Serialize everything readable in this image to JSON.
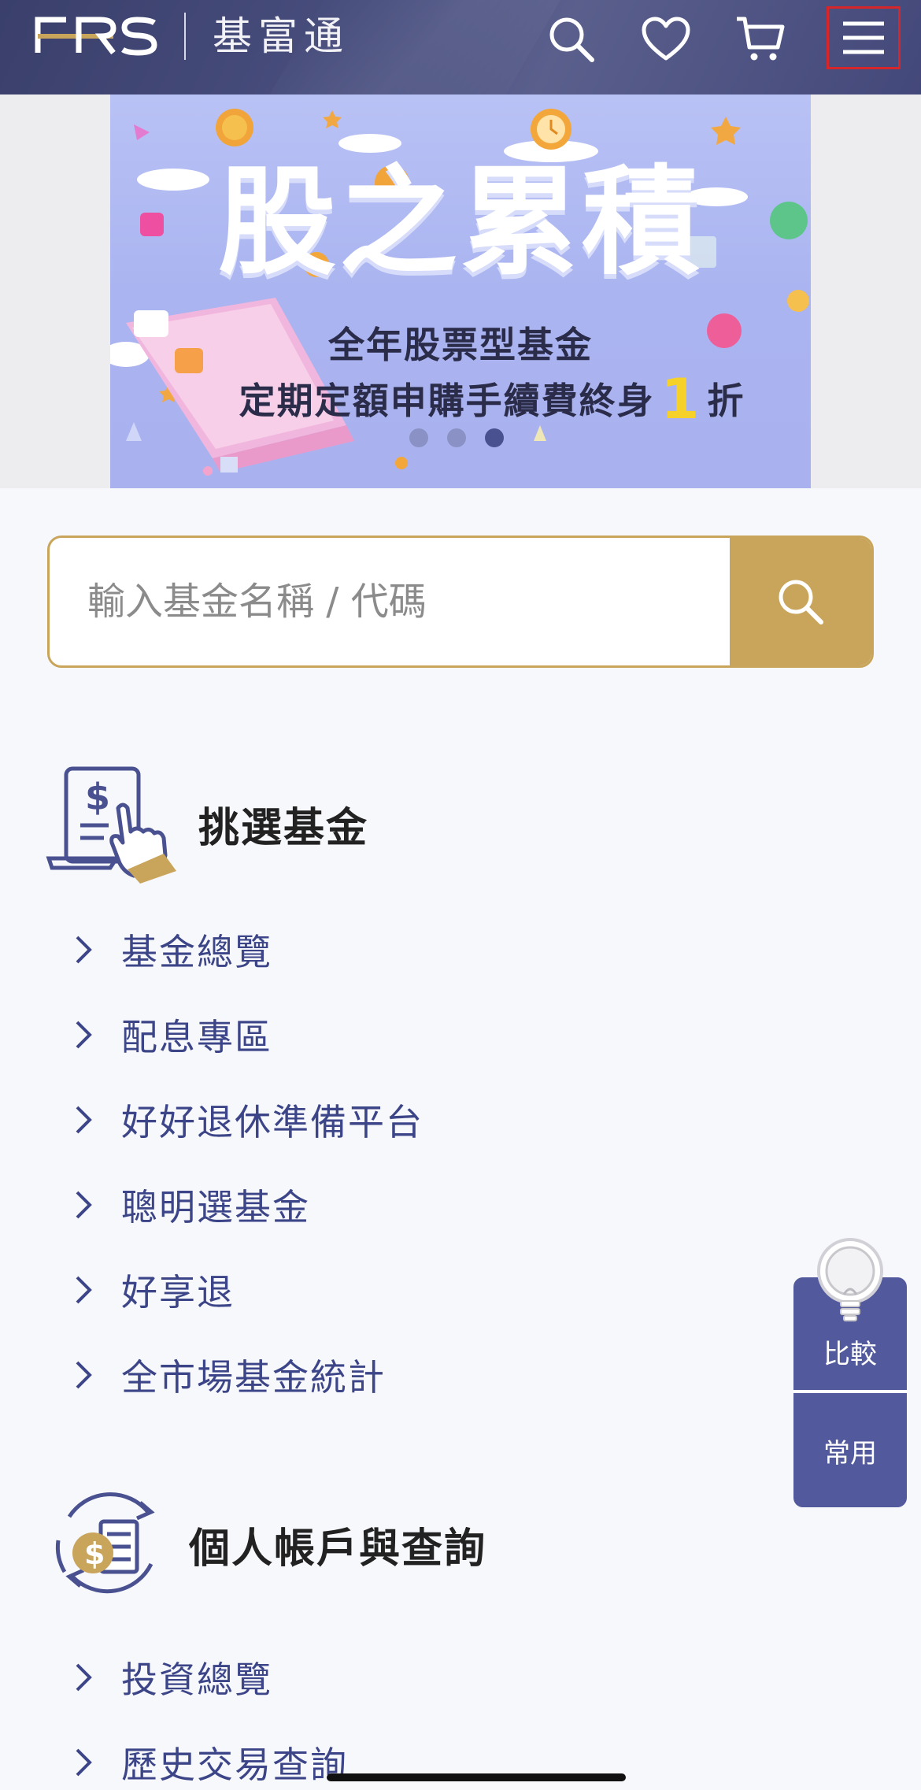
{
  "header": {
    "logo_text": "FRS",
    "brand_name": "基富通",
    "icons": [
      "search-icon",
      "heart-icon",
      "cart-icon",
      "menu-icon"
    ]
  },
  "banner": {
    "title": "股之累積",
    "line1": "全年股票型基金",
    "line2_prefix": "定期定額申購手續費終身",
    "line2_highlight": "1",
    "line2_suffix": "折",
    "active_slide": 3,
    "slide_count": 3
  },
  "search": {
    "placeholder": "輸入基金名稱 / 代碼"
  },
  "sections": [
    {
      "title": "挑選基金",
      "icon": "fund-select-icon",
      "items": [
        "基金總覽",
        "配息專區",
        "好好退休準備平台",
        "聰明選基金",
        "好享退",
        "全市場基金統計"
      ]
    },
    {
      "title": "個人帳戶與查詢",
      "icon": "account-query-icon",
      "items": [
        "投資總覽",
        "歷史交易查詢"
      ]
    }
  ],
  "float_panel": {
    "compare_label": "比較",
    "favorites_label": "常用"
  },
  "colors": {
    "header_bg": "#43487a",
    "accent_gold": "#c9a55b",
    "link_blue": "#3c4587",
    "panel_blue": "#525a9d"
  }
}
